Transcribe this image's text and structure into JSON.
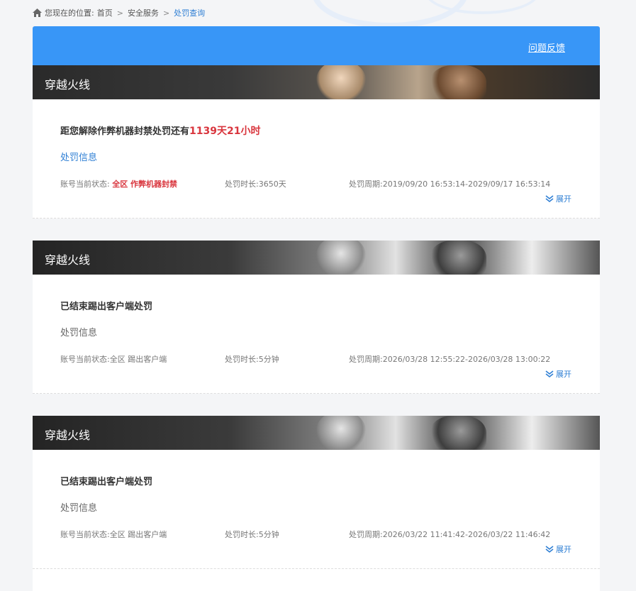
{
  "breadcrumb": {
    "prefix": "您现在的位置:",
    "items": [
      "首页",
      "安全服务",
      "处罚查询"
    ],
    "separator": ">"
  },
  "topbar": {
    "feedback_label": "问题反馈"
  },
  "colors": {
    "accent": "#3896f7",
    "link": "#2f7fd4",
    "alert": "#d9363e"
  },
  "records": [
    {
      "game": "穿越火线",
      "headline_prefix": "距您解除作弊机器封禁处罚还有",
      "headline_count": "1139天21小时",
      "info_label": "处罚信息",
      "status_label": "账号当前状态:",
      "status_value": "全区 作弊机器封禁",
      "duration_label": "处罚时长:",
      "duration_value": "3650天",
      "period_label": "处罚周期:",
      "period_value": "2019/09/20 16:53:14-2029/09/17 16:53:14",
      "expand_label": "展开"
    },
    {
      "game": "穿越火线",
      "headline_prefix": "已结束踢出客户端处罚",
      "info_label": "处罚信息",
      "status_label": "账号当前状态:",
      "status_value": "全区 踢出客户端",
      "duration_label": "处罚时长:",
      "duration_value": "5分钟",
      "period_label": "处罚周期:",
      "period_value": "2026/03/28 12:55:22-2026/03/28 13:00:22",
      "expand_label": "展开"
    },
    {
      "game": "穿越火线",
      "headline_prefix": "已结束踢出客户端处罚",
      "info_label": "处罚信息",
      "status_label": "账号当前状态:",
      "status_value": "全区 踢出客户端",
      "duration_label": "处罚时长:",
      "duration_value": "5分钟",
      "period_label": "处罚周期:",
      "period_value": "2026/03/22 11:41:42-2026/03/22 11:46:42",
      "expand_label": "展开"
    }
  ]
}
